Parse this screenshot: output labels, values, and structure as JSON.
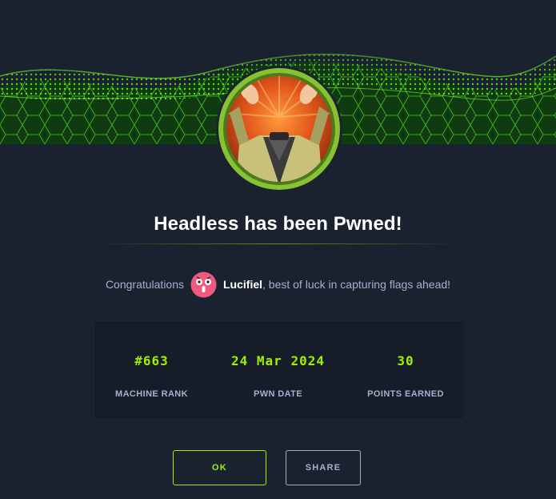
{
  "modal": {
    "title": "Headless has been Pwned!",
    "congrats_prefix": "Congratulations",
    "username": "Lucifiel",
    "congrats_suffix": ", best of luck in capturing flags ahead!"
  },
  "stats": [
    {
      "value": "#663",
      "label": "MACHINE RANK"
    },
    {
      "value": "24 Mar 2024",
      "label": "PWN DATE"
    },
    {
      "value": "30",
      "label": "POINTS EARNED"
    }
  ],
  "buttons": {
    "ok_label": "OK",
    "share_label": "SHARE"
  },
  "colors": {
    "background": "#1a2230",
    "accent_green": "#9fef00",
    "text_muted": "#a4b1cd"
  },
  "icons": {
    "banner": "green-hex-wave-banner",
    "machine": "headless-machine-avatar",
    "user": "user-avatar"
  }
}
